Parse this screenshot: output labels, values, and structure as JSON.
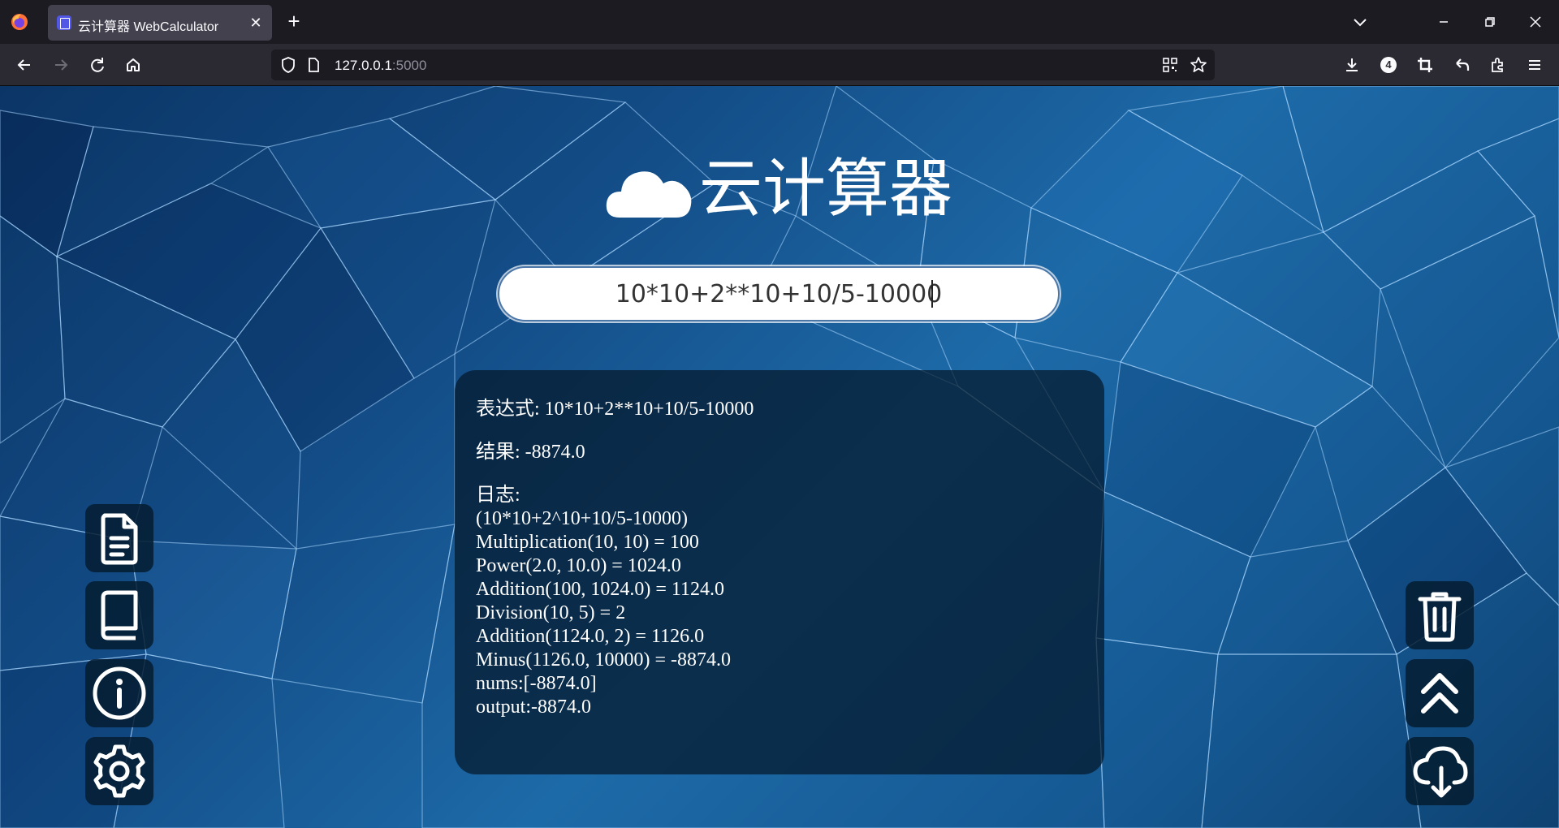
{
  "browser": {
    "tab_title": "云计算器 WebCalculator",
    "tab_close": "✕",
    "new_tab": "+",
    "url_host": "127.0.0.1",
    "url_port": ":5000",
    "extension_badge": "4"
  },
  "app": {
    "title": "云计算器",
    "expression_value": "10*10+2**10+10/5-10000",
    "result_panel": {
      "expression_line": "表达式: 10*10+2**10+10/5-10000",
      "result_line": "结果: -8874.0",
      "log_label": "日志:",
      "log_lines": [
        "(10*10+2^10+10/5-10000)",
        "Multiplication(10, 10) = 100",
        "Power(2.0, 10.0) = 1024.0",
        "Addition(100, 1024.0) = 1124.0",
        "Division(10, 5) = 2",
        "Addition(1124.0, 2) = 1126.0",
        "Minus(1126.0, 10000) = -8874.0",
        "nums:[-8874.0]",
        "output:-8874.0"
      ]
    },
    "left_buttons": [
      "document-icon",
      "book-icon",
      "info-icon",
      "gear-icon"
    ],
    "right_buttons": [
      "trash-icon",
      "chevrons-up-icon",
      "cloud-download-icon"
    ]
  },
  "colors": {
    "chrome_dark": "#1c1b22",
    "chrome_toolbar": "#2b2a33",
    "tab_active": "#42414d",
    "page_blue": "#1d6aa8",
    "panel_bg": "#04182a"
  }
}
